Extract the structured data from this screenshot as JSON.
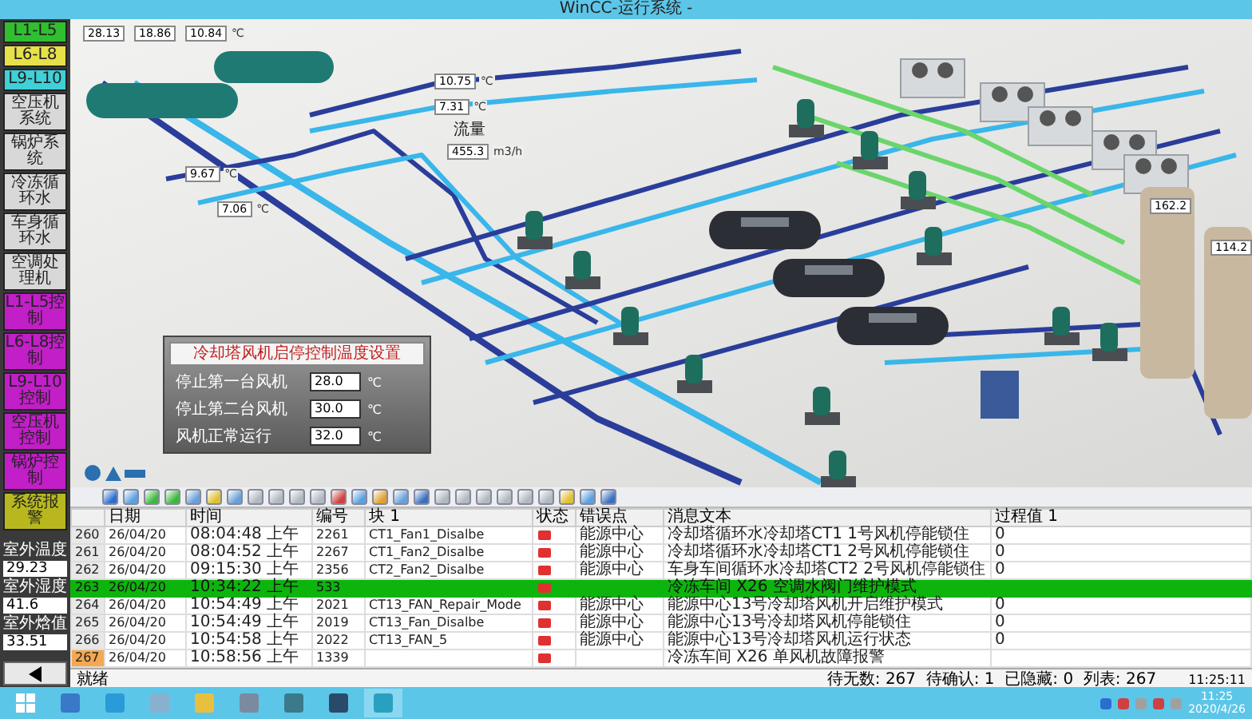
{
  "window": {
    "title": "WinCC-运行系统 -"
  },
  "sidebar": {
    "items": [
      {
        "label": "L1-L5",
        "color": "#2fbf2f"
      },
      {
        "label": "L6-L8",
        "color": "#e6e04a"
      },
      {
        "label": "L9-L10",
        "color": "#3fd0d8"
      },
      {
        "label": "空压机系统",
        "color": "#d8d8d8"
      },
      {
        "label": "锅炉系统",
        "color": "#d8d8d8"
      },
      {
        "label": "冷冻循环水",
        "color": "#d8d8d8"
      },
      {
        "label": "车身循环水",
        "color": "#d8d8d8"
      },
      {
        "label": "空调处理机",
        "color": "#d8d8d8"
      },
      {
        "label": "L1-L5控制",
        "color": "#c21fc8"
      },
      {
        "label": "L6-L8控制",
        "color": "#c21fc8"
      },
      {
        "label": "L9-L10控制",
        "color": "#c21fc8"
      },
      {
        "label": "空压机控制",
        "color": "#c21fc8"
      },
      {
        "label": "锅炉控制",
        "color": "#c21fc8"
      },
      {
        "label": "系统报警",
        "color": "#b8b81e"
      }
    ],
    "outdoor": [
      {
        "label": "室外温度",
        "value": "29.23"
      },
      {
        "label": "室外湿度",
        "value": "41.6"
      },
      {
        "label": "室外焓值",
        "value": "33.51"
      }
    ]
  },
  "diagram": {
    "readings": [
      {
        "value": "28.13"
      },
      {
        "value": "18.86"
      },
      {
        "value": "10.84",
        "unit": "℃"
      },
      {
        "value": "10.75",
        "unit": "℃"
      },
      {
        "value": "7.31",
        "unit": "℃"
      },
      {
        "value": "455.3",
        "unit": "m3/h"
      },
      {
        "value": "9.67",
        "unit": "℃"
      },
      {
        "value": "7.06",
        "unit": "℃"
      },
      {
        "value": "162.2"
      },
      {
        "value": "114.2"
      }
    ],
    "flow_label": "流量",
    "settings_panel": {
      "title": "冷却塔风机启停控制温度设置",
      "rows": [
        {
          "label": "停止第一台风机",
          "value": "28.0",
          "unit": "℃"
        },
        {
          "label": "停止第二台风机",
          "value": "30.0",
          "unit": "℃"
        },
        {
          "label": "风机正常运行",
          "value": "32.0",
          "unit": "℃"
        }
      ]
    }
  },
  "alarm_table": {
    "columns": [
      "",
      "日期",
      "时间",
      "编号",
      "块 1",
      "状态",
      "错误点",
      "消息文本",
      "过程值 1"
    ],
    "rows": [
      {
        "number": "260",
        "date": "26/04/20",
        "time": "08:04:48 上午",
        "id": "2261",
        "block": "CT1_Fan1_Disalbe",
        "location": "能源中心",
        "message": "冷却塔循环水冷却塔CT1 1号风机停能锁住",
        "value": "0",
        "selected": false,
        "pending": false
      },
      {
        "number": "261",
        "date": "26/04/20",
        "time": "08:04:52 上午",
        "id": "2267",
        "block": "CT1_Fan2_Disalbe",
        "location": "能源中心",
        "message": "冷却塔循环水冷却塔CT1 2号风机停能锁住",
        "value": "0",
        "selected": false,
        "pending": false
      },
      {
        "number": "262",
        "date": "26/04/20",
        "time": "09:15:30 上午",
        "id": "2356",
        "block": "CT2_Fan2_Disalbe",
        "location": "能源中心",
        "message": "车身车间循环水冷却塔CT2 2号风机停能锁住",
        "value": "0",
        "selected": false,
        "pending": false
      },
      {
        "number": "263",
        "date": "26/04/20",
        "time": "10:34:22 上午",
        "id": "533",
        "block": "",
        "location": "",
        "message": "冷冻车间 X26 空调水阀门维护模式",
        "value": "",
        "selected": true,
        "pending": false
      },
      {
        "number": "264",
        "date": "26/04/20",
        "time": "10:54:49 上午",
        "id": "2021",
        "block": "CT13_FAN_Repair_Mode",
        "location": "能源中心",
        "message": "能源中心13号冷却塔风机开启维护模式",
        "value": "0",
        "selected": false,
        "pending": false
      },
      {
        "number": "265",
        "date": "26/04/20",
        "time": "10:54:49 上午",
        "id": "2019",
        "block": "CT13_Fan_Disalbe",
        "location": "能源中心",
        "message": "能源中心13号冷却塔风机停能锁住",
        "value": "0",
        "selected": false,
        "pending": false
      },
      {
        "number": "266",
        "date": "26/04/20",
        "time": "10:54:58 上午",
        "id": "2022",
        "block": "CT13_FAN_5",
        "location": "能源中心",
        "message": "能源中心13号冷却塔风机运行状态",
        "value": "0",
        "selected": false,
        "pending": false
      },
      {
        "number": "267",
        "date": "26/04/20",
        "time": "10:58:56 上午",
        "id": "1339",
        "block": "",
        "location": "",
        "message": "冷冻车间 X26 单风机故障报警",
        "value": "",
        "selected": false,
        "pending": true
      }
    ]
  },
  "status_bar": {
    "ready": "就绪",
    "counts": "待无数: 267  待确认: 1  已隐藏: 0  列表: 267",
    "time": "11:25:11"
  },
  "taskbar": {
    "time": "11:25",
    "date": "2020/4/26"
  }
}
